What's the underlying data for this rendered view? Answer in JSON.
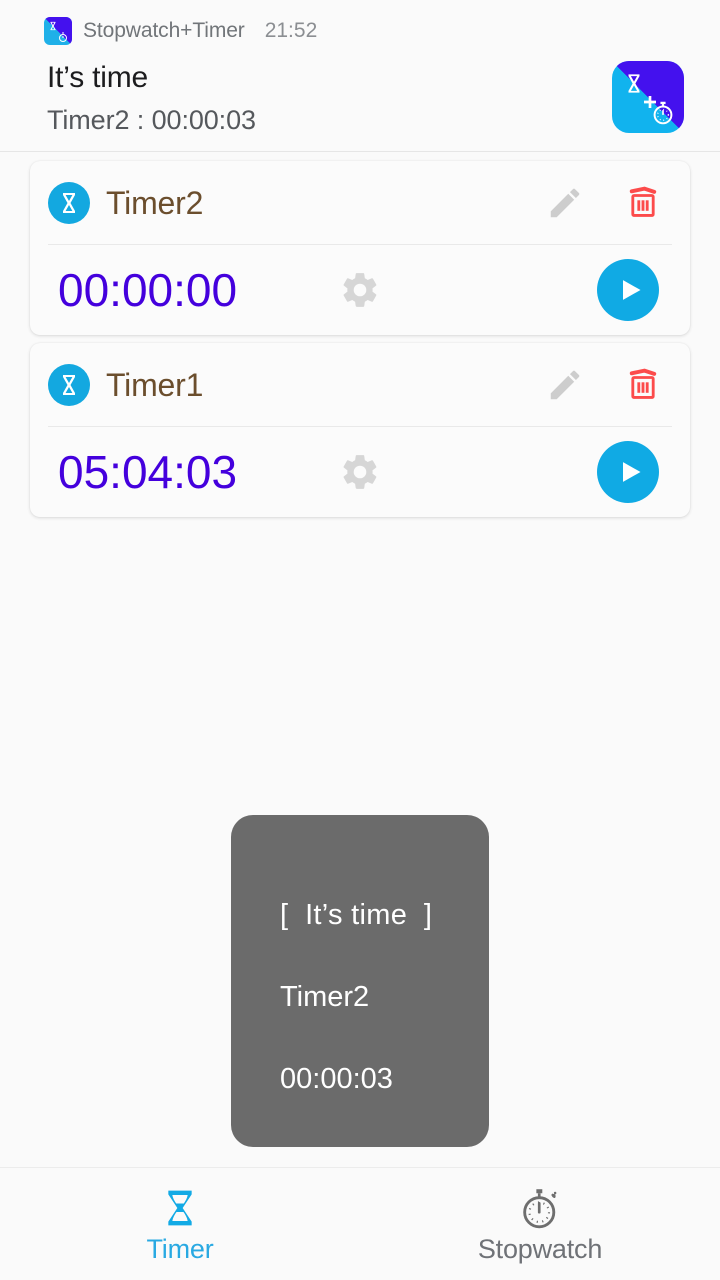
{
  "notification": {
    "app_icon": "stopwatch-timer-app-icon",
    "app_name": "Stopwatch+Timer",
    "time": "21:52",
    "title": "It’s time",
    "subtitle": "Timer2 : 00:00:03",
    "large_icon": "stopwatch-timer-app-icon"
  },
  "timers": [
    {
      "icon": "hourglass-icon",
      "name": "Timer2",
      "time": "00:00:00",
      "edit_icon": "pencil-icon",
      "delete_icon": "trash-icon",
      "settings_icon": "gear-icon",
      "play_icon": "play-icon"
    },
    {
      "icon": "hourglass-icon",
      "name": "Timer1",
      "time": "05:04:03",
      "edit_icon": "pencil-icon",
      "delete_icon": "trash-icon",
      "settings_icon": "gear-icon",
      "play_icon": "play-icon"
    }
  ],
  "toast": {
    "line1": "[  It’s time  ]",
    "line2": "Timer2",
    "line3": "00:00:03"
  },
  "bottom_nav": {
    "items": [
      {
        "label": "Timer",
        "icon": "hourglass-icon",
        "active": true
      },
      {
        "label": "Stopwatch",
        "icon": "stopwatch-icon",
        "active": false
      }
    ]
  },
  "colors": {
    "accent_cyan": "#12aae5",
    "timer_digits": "#4400dd",
    "timer_name": "#6b4e2d",
    "delete_red": "#fc4b4b",
    "toast_bg": "#6b6b6b",
    "app_purple": "#4411ee"
  }
}
